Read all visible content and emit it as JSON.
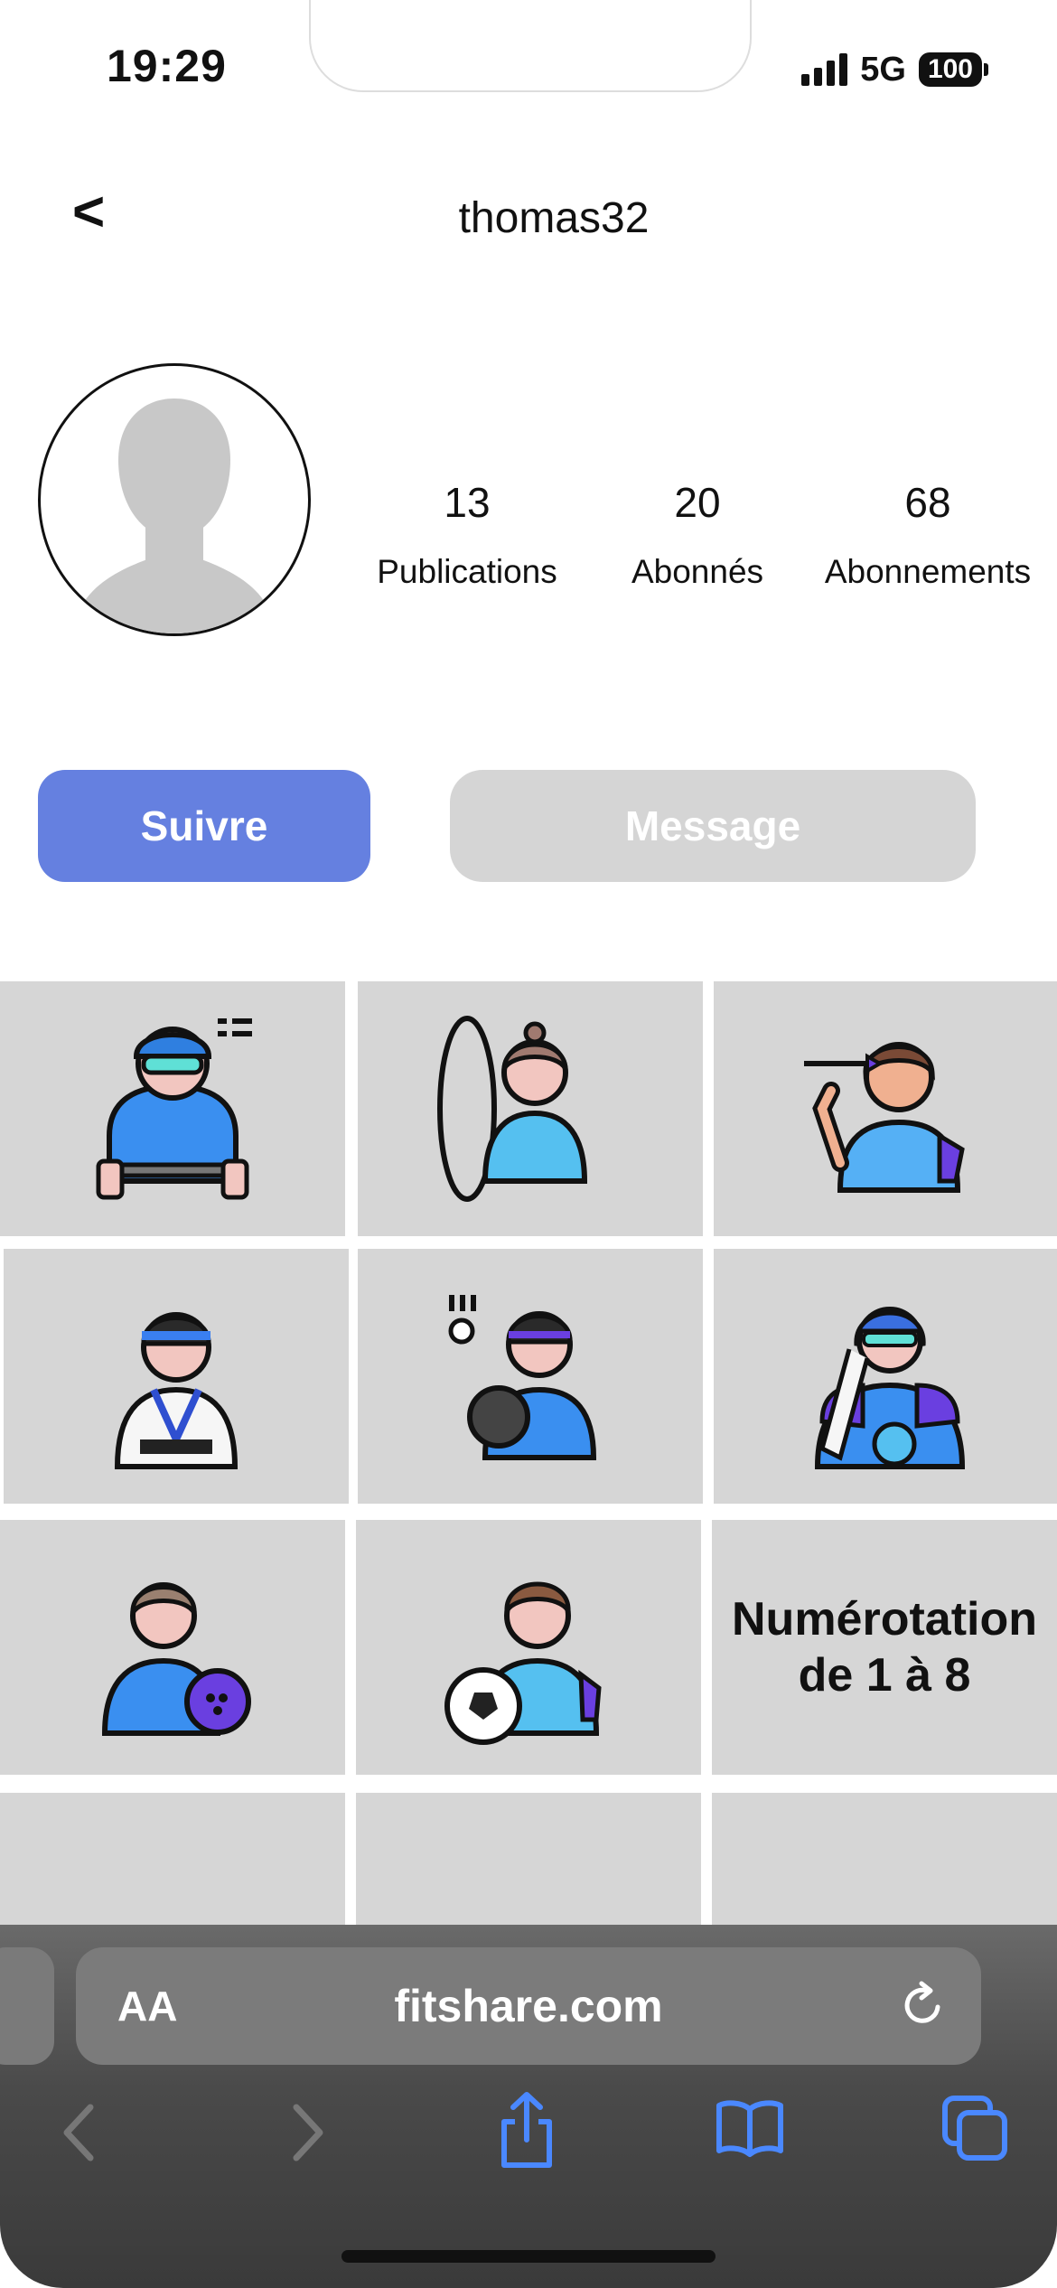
{
  "status_bar": {
    "time": "19:29",
    "network": "5G",
    "battery": "100"
  },
  "header": {
    "back_label": "<",
    "username": "thomas32"
  },
  "profile": {
    "stats": [
      {
        "value": "13",
        "label": "Publications"
      },
      {
        "value": "20",
        "label": "Abonnés"
      },
      {
        "value": "68",
        "label": "Abonnements"
      }
    ]
  },
  "actions": {
    "follow_label": "Suivre",
    "message_label": "Message"
  },
  "grid": {
    "items": [
      {
        "icon": "cyclist-icon"
      },
      {
        "icon": "hula-hoop-icon"
      },
      {
        "icon": "darts-player-icon"
      },
      {
        "icon": "karate-icon"
      },
      {
        "icon": "bowling-player-icon"
      },
      {
        "icon": "hockey-player-icon"
      },
      {
        "icon": "bowler-icon"
      },
      {
        "icon": "soccer-player-icon"
      },
      {
        "text": "Numérotation de 1 à 8"
      }
    ]
  },
  "browser": {
    "text_size_label": "AA",
    "url": "fitshare.com"
  },
  "colors": {
    "accent": "#6580e0",
    "tile": "#d6d6d6",
    "message_bg": "#d5d5d5",
    "icon_blue": "#3aa0f0",
    "icon_purple": "#6a3fe0"
  }
}
